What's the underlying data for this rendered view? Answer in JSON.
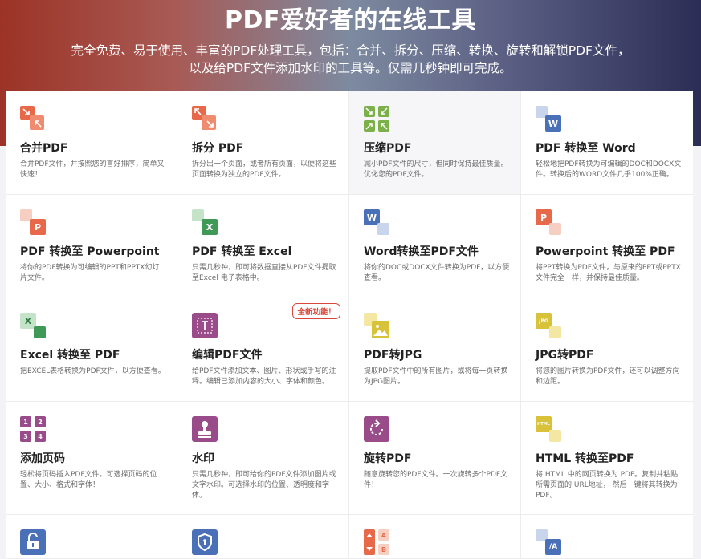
{
  "hero": {
    "title": "PDF爱好者的在线工具",
    "subtitle": "完全免费、易于使用、丰富的PDF处理工具，包括：合并、拆分、压缩、转换、旋转和解锁PDF文件，以及给PDF文件添加水印的工具等。仅需几秒钟即可完成。"
  },
  "colors": {
    "orange": "#e8694a",
    "green": "#7bb04a",
    "excel_green": "#3f9a58",
    "word_blue": "#4a70b8",
    "purple": "#9a4c8a",
    "yellow": "#d8c23a",
    "badge_red": "#d9473b"
  },
  "tools": [
    {
      "title": "合并PDF",
      "desc": "合并PDF文件，并按照您的喜好排序，简单又快速！",
      "icon": "merge-icon"
    },
    {
      "title": "拆分 PDF",
      "desc": "拆分出一个页面，或者所有页面，以便将这些页面转换为独立的PDF文件。",
      "icon": "split-icon"
    },
    {
      "title": "压缩PDF",
      "desc": "减小PDF文件的尺寸，但同时保持最佳质量。优化您的PDF文件。",
      "icon": "compress-icon"
    },
    {
      "title": "PDF 转换至 Word",
      "desc": "轻松地把PDF转换为可编辑的DOC和DOCX文件。转换后的WORD文件几乎100%正确。",
      "icon": "pdf-to-word-icon",
      "glyph": "W"
    },
    {
      "title": "PDF 转换至 Powerpoint",
      "desc": "将你的PDF转换为可编辑的PPT和PPTX幻灯片文件。",
      "icon": "pdf-to-ppt-icon",
      "glyph": "P"
    },
    {
      "title": "PDF 转换至 Excel",
      "desc": "只需几秒钟，即可将数据直接从PDF文件提取至Excel 电子表格中。",
      "icon": "pdf-to-excel-icon",
      "glyph": "X"
    },
    {
      "title": "Word转换至PDF文件",
      "desc": "将你的DOC或DOCX文件转换为PDF，以方便查看。",
      "icon": "word-to-pdf-icon",
      "glyph": "W"
    },
    {
      "title": "Powerpoint 转换至 PDF",
      "desc": "将PPT转换为PDF文件，与原来的PPT或PPTX文件完全一样，并保持最佳质量。",
      "icon": "ppt-to-pdf-icon",
      "glyph": "P"
    },
    {
      "title": "Excel 转换至 PDF",
      "desc": "把EXCEL表格转换为PDF文件，以方便查看。",
      "icon": "excel-to-pdf-icon",
      "glyph": "X"
    },
    {
      "title": "编辑PDF文件",
      "desc": "给PDF文件添加文本、图片、形状或手写的注释。编辑已添加内容的大小、字体和颜色。",
      "icon": "edit-pdf-icon",
      "badge": "全新功能！"
    },
    {
      "title": "PDF转JPG",
      "desc": "提取PDF文件中的所有图片，或将每一页转换为JPG图片。",
      "icon": "pdf-to-jpg-icon"
    },
    {
      "title": "JPG转PDF",
      "desc": "将您的图片转换为PDF文件，还可以调整方向和边距。",
      "icon": "jpg-to-pdf-icon",
      "glyph": "JPG"
    },
    {
      "title": "添加页码",
      "desc": "轻松将页码插入PDF文件。可选择页码的位置、大小、格式和字体！",
      "icon": "page-numbers-icon",
      "digits": [
        "1",
        "2",
        "3",
        "4"
      ]
    },
    {
      "title": "水印",
      "desc": "只需几秒钟，即可给你的PDF文件添加图片或文字水印。可选择水印的位置、透明度和字体。",
      "icon": "watermark-icon"
    },
    {
      "title": "旋转PDF",
      "desc": "随意旋转您的PDF文件。一次旋转多个PDF文件！",
      "icon": "rotate-icon"
    },
    {
      "title": "HTML 转换至PDF",
      "desc": "将 HTML 中的网页转换为 PDF。复制并粘贴所需页面的 URL地址， 然后一键将其转换为PDF。",
      "icon": "html-to-pdf-icon",
      "glyph": "HTML"
    },
    {
      "icon": "unlock-icon"
    },
    {
      "icon": "protect-icon"
    },
    {
      "icon": "organize-icon",
      "glyphs": [
        "A",
        "B"
      ]
    },
    {
      "icon": "ocr-icon",
      "glyph": "/A"
    }
  ]
}
